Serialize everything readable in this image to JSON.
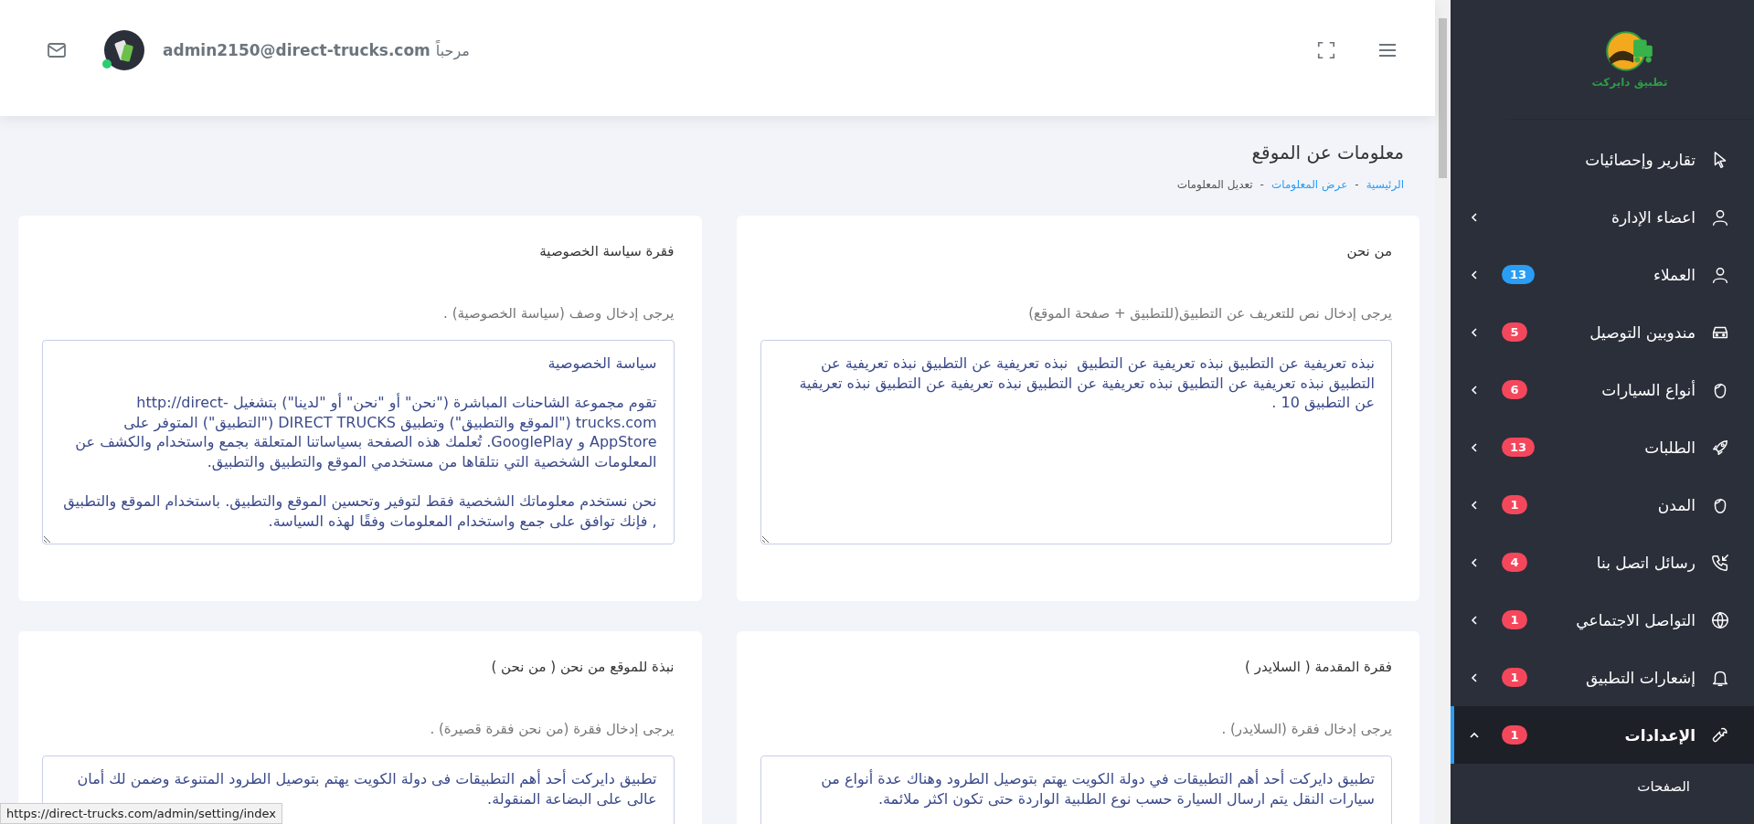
{
  "header": {
    "greeting": "مرحباً",
    "user_email": "admin2150@direct-trucks.com",
    "online": true
  },
  "logo": {
    "text": "تطبيق دايركت"
  },
  "sidebar": {
    "items": [
      {
        "label": "تقارير وإحصائيات",
        "kind": "link",
        "selected": false
      },
      {
        "label": "اعضاء الإدارة",
        "kind": "group",
        "expanded": false,
        "selected": false
      },
      {
        "label": "العملاء",
        "kind": "group",
        "badge": "13",
        "color": "#2a9df4",
        "expanded": false,
        "selected": false
      },
      {
        "label": "مندوبين التوصيل",
        "kind": "group",
        "badge": "5",
        "color": "#f5475c",
        "expanded": false,
        "selected": false
      },
      {
        "label": "أنواع السيارات",
        "kind": "group",
        "badge": "6",
        "color": "#f5475c",
        "expanded": false,
        "selected": false
      },
      {
        "label": "الطلبات",
        "kind": "group",
        "badge": "13",
        "color": "#f5475c",
        "expanded": false,
        "selected": false
      },
      {
        "label": "المدن",
        "kind": "group",
        "badge": "1",
        "color": "#f5475c",
        "expanded": false,
        "selected": false
      },
      {
        "label": "رسائل اتصل بنا",
        "kind": "group",
        "badge": "4",
        "color": "#f5475c",
        "expanded": false,
        "selected": false
      },
      {
        "label": "التواصل الاجتماعي",
        "kind": "group",
        "badge": "1",
        "color": "#f5475c",
        "expanded": false,
        "selected": false
      },
      {
        "label": "إشعارات التطبيق",
        "kind": "group",
        "badge": "1",
        "color": "#f5475c",
        "expanded": false,
        "selected": false
      },
      {
        "label": "الإعدادات",
        "kind": "group",
        "badge": "1",
        "color": "#f5475c",
        "expanded": true,
        "selected": true,
        "children": [
          {
            "label": "الصفحات"
          }
        ]
      }
    ]
  },
  "page": {
    "title": "معلومات عن الموقع",
    "breadcrumb": [
      {
        "label": "الرئيسية",
        "link": true
      },
      {
        "label": "عرض المعلومات",
        "link": true
      },
      {
        "label": "تعديل المعلومات",
        "link": false
      }
    ],
    "separator": "-"
  },
  "cards": [
    {
      "title": "من نحن",
      "label": "يرجى إدخال نص للتعريف عن التطبيق(للتطبيق + صفحة الموقع)",
      "value": "نبذه تعريفية عن التطبيق نبذه تعريفية عن التطبيق  نبذه تعريفية عن التطبيق نبذه تعريفية عن التطبيق نبذه تعريفية عن التطبيق نبذه تعريفية عن التطبيق نبذه تعريفية عن التطبيق نبذه تعريفية عن التطبيق 10 ."
    },
    {
      "title": "فقرة سياسة الخصوصية",
      "label": "يرجى إدخال وصف (سياسة الخصوصية) .",
      "value": "سياسة الخصوصية\n\nتقوم مجموعة الشاحنات المباشرة (\"نحن\" أو \"نحن\" أو \"لدينا\") بتشغيل http://direct-trucks.com (\"الموقع والتطبيق\") وتطبيق DIRECT TRUCKS (\"التطبيق\") المتوفر على AppStore و GooglePlay. تُعلمك هذه الصفحة بسياساتنا المتعلقة بجمع واستخدام والكشف عن المعلومات الشخصية التي نتلقاها من مستخدمي الموقع والتطبيق والتطبيق.\n\nنحن نستخدم معلوماتك الشخصية فقط لتوفير وتحسين الموقع والتطبيق. باستخدام الموقع والتطبيق , فإنك توافق على جمع واستخدام المعلومات وفقًا لهذه السياسة."
    },
    {
      "title": "فقرة المقدمة ( السلايدر )",
      "label": "يرجى إدخال فقرة (السلايدر) .",
      "value": "تطبيق دايركت أحد أهم التطبيقات في دولة الكويت يهتم بتوصيل الطرود وهناك عدة أنواع من سيارات النقل يتم ارسال السيارة حسب نوع الطلبية الواردة حتى تكون اكثر ملائمة."
    },
    {
      "title": "نبذة للموقع من نحن ( من نحن )",
      "label": "يرجى إدخال فقرة (من نحن فقرة قصيرة) .",
      "value": "تطبيق دايركت أحد أهم التطبيقات فى دولة الكويت يهتم بتوصيل الطرود المتنوعة وضمن لك أمان عالى على البضاعة المنقولة."
    }
  ],
  "status_bar": {
    "url": "https://direct-trucks.com/admin/setting/index"
  }
}
